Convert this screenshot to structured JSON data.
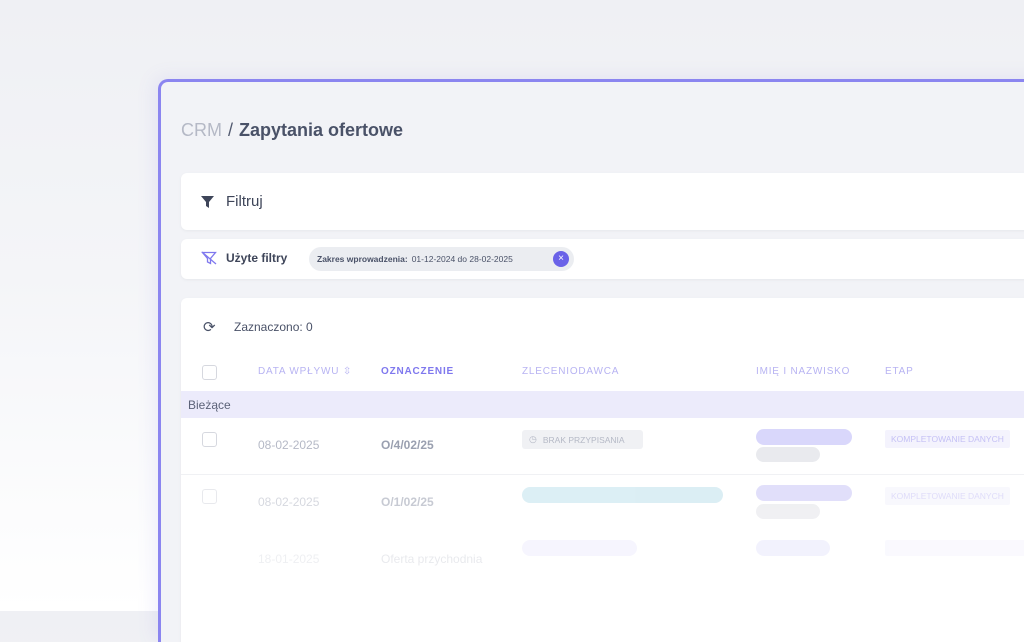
{
  "breadcrumb": {
    "root": "CRM",
    "separator": "/",
    "current": "Zapytania ofertowe"
  },
  "filter_bar": {
    "label": "Filtruj",
    "icon": "funnel-icon"
  },
  "used_filters": {
    "label": "Użyte filtry",
    "icon": "filter-off-icon",
    "chips": [
      {
        "key": "Zakres wprowadzenia:",
        "value": "01-12-2024 do 28-02-2025"
      }
    ]
  },
  "table": {
    "selected_text": "Zaznaczono: 0",
    "columns": [
      "DATA WPŁYWU",
      "OZNACZENIE",
      "ZLECENIODAWCA",
      "IMIĘ I NAZWISKO",
      "ETAP"
    ],
    "group_label": "Bieżące",
    "rows": [
      {
        "date": "08-02-2025",
        "code": "O/4/02/25",
        "client": "BRAK PRZYPISANIA",
        "stage": "KOMPLETOWANIE DANYCH"
      },
      {
        "date": "08-02-2025",
        "code": "O/1/02/25",
        "client": "",
        "stage": "KOMPLETOWANIE DANYCH"
      },
      {
        "date": "18-01-2025",
        "code": "Oferta przychodnia",
        "client": "",
        "stage": ""
      }
    ]
  },
  "colors": {
    "accent": "#6a62e8",
    "accent_light": "#b7b3f2",
    "group_bg": "#ecebfb"
  }
}
